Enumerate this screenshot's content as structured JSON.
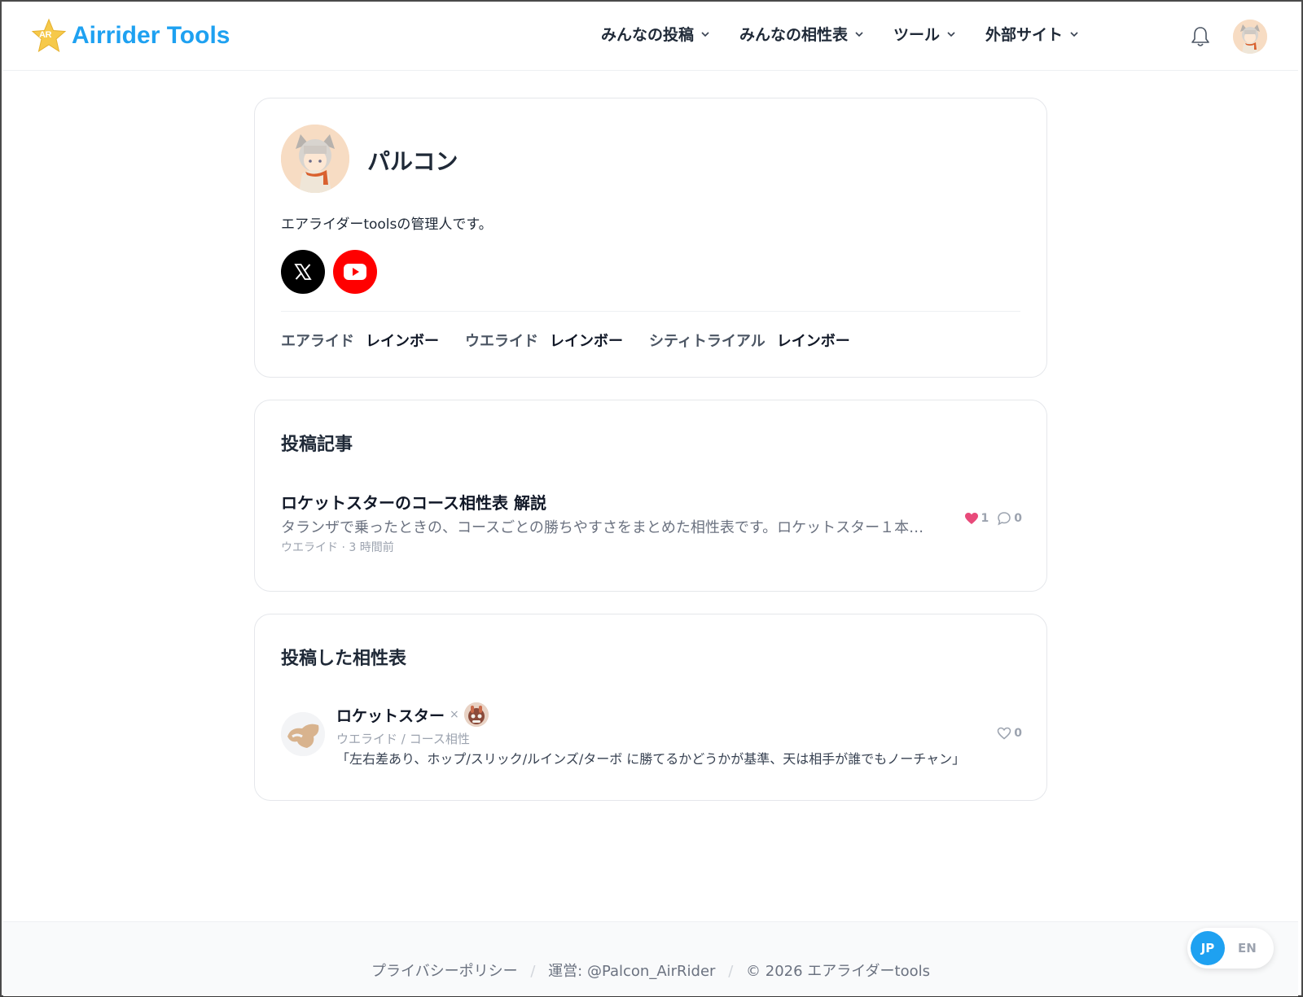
{
  "header": {
    "logo_badge": "AR",
    "logo_text": "Airrider Tools",
    "nav": [
      {
        "label": "みんなの投稿"
      },
      {
        "label": "みんなの相性表"
      },
      {
        "label": "ツール"
      },
      {
        "label": "外部サイト"
      }
    ]
  },
  "profile": {
    "name": "パルコン",
    "bio": "エアライダーtoolsの管理人です。",
    "ranks": [
      {
        "label": "エアライド",
        "value": "レインボー"
      },
      {
        "label": "ウエライド",
        "value": "レインボー"
      },
      {
        "label": "シティトライアル",
        "value": "レインボー"
      }
    ]
  },
  "posts": {
    "title": "投稿記事",
    "items": [
      {
        "title": "ロケットスターのコース相性表 解説",
        "excerpt": "タランザで乗ったときの、コースごとの勝ちやすさをまとめた相性表です。ロケットスター１本…",
        "meta": "ウエライド · 3 時間前",
        "likes": "1",
        "comments": "0"
      }
    ]
  },
  "tierlists": {
    "title": "投稿した相性表",
    "items": [
      {
        "name": "ロケットスター",
        "sep": "×",
        "sub": "ウエライド / コース相性",
        "desc": "「左右差あり、ホップ/スリック/ルインズ/ターボ に勝てるかどうかが基準、天は相手が誰でもノーチャン」",
        "likes": "0"
      }
    ]
  },
  "footer": {
    "privacy": "プライバシーポリシー",
    "operator": "運営: @Palcon_AirRider",
    "copyright": "© 2026 エアライダーtools",
    "sep": "/"
  },
  "lang": {
    "jp": "JP",
    "en": "EN"
  },
  "colors": {
    "brand": "#1ea1f1",
    "like": "#e84a7a",
    "youtube": "#ff0000"
  }
}
